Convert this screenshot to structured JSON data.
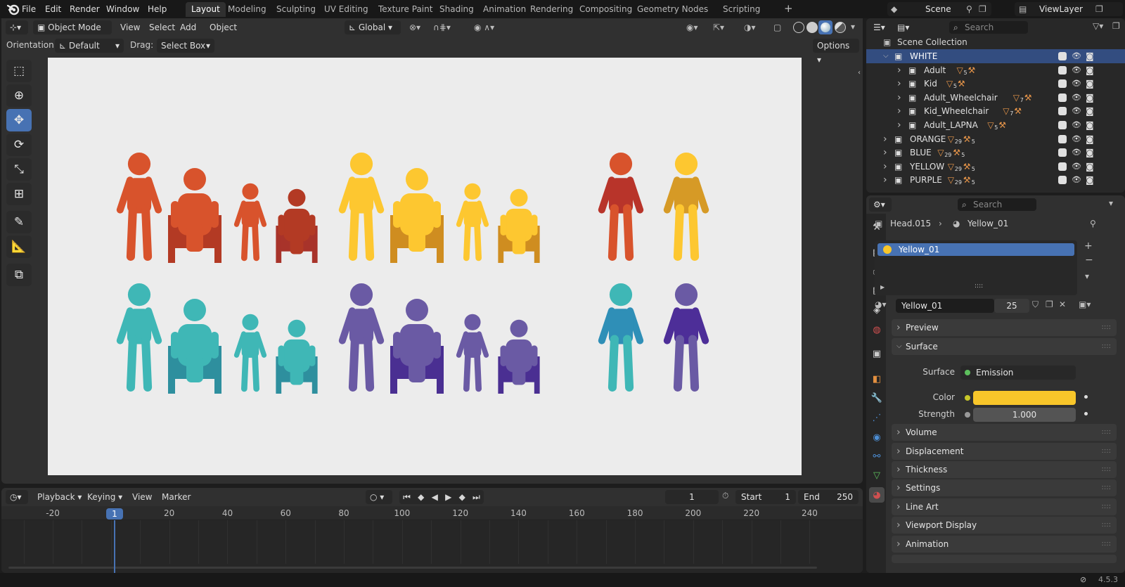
{
  "app": {
    "logo": "blender-logo-icon",
    "version": "4.5.3"
  },
  "menu": [
    "File",
    "Edit",
    "Render",
    "Window",
    "Help"
  ],
  "workspaces": [
    "Layout",
    "Modeling",
    "Sculpting",
    "UV Editing",
    "Texture Paint",
    "Shading",
    "Animation",
    "Rendering",
    "Compositing",
    "Geometry Nodes",
    "Scripting"
  ],
  "active_workspace": "Layout",
  "scene": {
    "name": "Scene",
    "view_layer": "ViewLayer"
  },
  "viewport": {
    "mode": "Object Mode",
    "menus": [
      "View",
      "Select",
      "Add",
      "Object"
    ],
    "transform_orientation": "Global",
    "orientation_label": "Orientation:",
    "orientation_value": "Default",
    "drag_label": "Drag:",
    "drag_value": "Select Box",
    "options_label": "Options",
    "figure_colors": {
      "orange": "#d8532c",
      "orange_dark": "#b33a24",
      "yellow": "#fdc730",
      "yellow_dark": "#cf8d20",
      "teal": "#3fb7b6",
      "teal_dark": "#2e8f9e",
      "purple": "#6a5aa4",
      "purple_dark": "#4a2f92",
      "red_shirt": "#b8342a",
      "blue_shirt": "#2f8fb7",
      "indigo_shirt": "#4d2e98",
      "ochre_shirt": "#d69a26"
    }
  },
  "toolbar": [
    "select-box-icon",
    "cursor-icon",
    "move-icon",
    "rotate-icon",
    "scale-icon",
    "transform-icon",
    "annotate-icon",
    "measure-icon",
    "add-cube-icon"
  ],
  "timeline": {
    "menus": [
      "Playback",
      "Keying",
      "View",
      "Marker"
    ],
    "current_frame": "1",
    "start_label": "Start",
    "start": "1",
    "end_label": "End",
    "end": "250",
    "ruler": [
      "-20",
      "20",
      "40",
      "60",
      "80",
      "100",
      "120",
      "140",
      "160",
      "180",
      "200",
      "220",
      "240"
    ],
    "playhead": "1"
  },
  "outliner": {
    "search_placeholder": "Search",
    "root": "Scene Collection",
    "rows": [
      {
        "name": "WHITE",
        "level": 1,
        "expanded": true,
        "selected": true,
        "tris": "",
        "obj": ""
      },
      {
        "name": "Adult",
        "level": 2,
        "tris": "5",
        "obj": ""
      },
      {
        "name": "Kid",
        "level": 2,
        "tris": "5",
        "obj": ""
      },
      {
        "name": "Adult_Wheelchair",
        "level": 2,
        "tris": "7",
        "obj": ""
      },
      {
        "name": "Kid_Wheelchair",
        "level": 2,
        "tris": "7",
        "obj": ""
      },
      {
        "name": "Adult_LAPNA",
        "level": 2,
        "tris": "5",
        "obj": ""
      },
      {
        "name": "ORANGE",
        "level": 1,
        "tris": "29",
        "obj": "5"
      },
      {
        "name": "BLUE",
        "level": 1,
        "tris": "29",
        "obj": "5"
      },
      {
        "name": "YELLOW",
        "level": 1,
        "tris": "29",
        "obj": "5"
      },
      {
        "name": "PURPLE",
        "level": 1,
        "tris": "29",
        "obj": "5"
      }
    ]
  },
  "properties": {
    "search_placeholder": "Search",
    "object": "Head.015",
    "material": "Yellow_01",
    "slot": "Yellow_01",
    "material_field": "Yellow_01",
    "users": "25",
    "panels_top": [
      "Preview"
    ],
    "surface_header": "Surface",
    "surface_label": "Surface",
    "surface_value": "Emission",
    "color_label": "Color",
    "color_value": "#f8c62a",
    "strength_label": "Strength",
    "strength_value": "1.000",
    "panels_bottom": [
      "Volume",
      "Displacement",
      "Thickness",
      "Settings",
      "Line Art",
      "Viewport Display",
      "Animation"
    ]
  }
}
